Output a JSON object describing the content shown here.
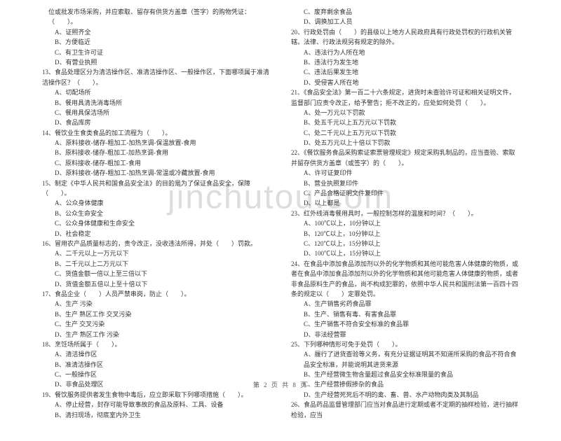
{
  "watermark": "jinchutou.com",
  "footer": "第 2 页 共 8 页",
  "left": {
    "q12_tail": "位或批发市场采购，并应索取、留存有供货方盖章（签字）的购物凭证：（　　）。",
    "q12": {
      "A": "A、证照齐全",
      "B": "B、方便临近",
      "C": "C、有卫生许可证",
      "D": "D、有营业执照"
    },
    "q13": {
      "stem": "13、食品处理区分为清洁操作区、准清洁操作区、一般操作区，下面哪项属于准清洁操作区？（　　）。",
      "A": "A、切配场所",
      "B": "B、餐用具清洗消毒场所",
      "C": "C、餐用具保洁场所",
      "D": "D、食品库房"
    },
    "q14": {
      "stem": "14、餐饮业生食类食品的加工流程为（　　）。",
      "A": "A、原料接收-储存-粗加工-加热烹调-保温放置-食用",
      "B": "B、原料接收-储存-粗加工-加热烹调-食用",
      "C": "C、原料接收-储存-粗加工-食用",
      "D": "D、原料接收-储存-粗加工-加热烹调-常温或冷藏放置-食用"
    },
    "q15": {
      "stem": "15、制定《中华人民共和国食品安全法》的目的是为了保证食品安全，保障（　　）。",
      "A": "A、公众身体健康",
      "B": "B、公众生命安全",
      "C": "C、公众身体健康和生命安全",
      "D": "D、社会稳定"
    },
    "q16": {
      "stem": "16、冒用农产品质量标志的，责令改正，没收违法所得，并处（　　）罚款。",
      "A": "A、二千元以上一万元以下",
      "B": "B、二千元以上二万元以下",
      "C": "C、货值金额一倍以上至三倍以下",
      "D": "D、货值金额五倍以上至十倍以下"
    },
    "q17": {
      "stem": "17、食品企业（　　）人员严禁串岗，防止（　　）。",
      "A": "A、生产  污染",
      "B": "B、生产  熟区工作  交叉污染",
      "C": "C、生产  交叉污染",
      "D": "D、生产  熟区工作  污染"
    },
    "q18": {
      "stem": "18、烹饪场所属于（　　）。",
      "A": "A、清洁操作区",
      "B": "B、准清洁操作区",
      "C": "C、一般操作区",
      "D": "D、非食品处理区"
    },
    "q19": {
      "stem": "19、餐饮服务提供者发生食物中毒后，应立即采取下列哪项措施（　　）。",
      "A": "A、停止经营，封存可能导致事故的食品及原料、工具、设备",
      "B": "B、清扫现场，彻底室内外卫生"
    }
  },
  "right": {
    "q19": {
      "C": "C、废弃剩余食品",
      "D": "D、调换加工人员"
    },
    "q20": {
      "stem": "20、行政处罚由（　　）的县级以上地方人民政府具有行政处罚权的行政机关管辖。法律、行政法规另有规定的除外。",
      "A": "A、违法行为人所在地",
      "B": "B、违法行为发生地",
      "C": "C、违法后果发生地",
      "D": "D、受侵害人所在地"
    },
    "q21": {
      "stem": "21、《食品安全法》第一百二十六条规定，进货时未查验许可证和相关证明文件，监督部门应责令改正，给予警告；拒不改正的，应处如何处罚（　　）。",
      "A": "A、处一万元以下罚款",
      "B": "B、处五千元以上五万元以下罚款",
      "C": "C、处二千元以上五万元以下罚款",
      "D": "D、处五万元以上十倍以下罚款"
    },
    "q22": {
      "stem": "22、《餐饮服务食品采购索证索票管理规定》规定采购乳制品的，应当查验、索取并留存供货方盖章（或签字）的（　　）。",
      "A": "A、许可证复印件",
      "B": "B、营业执照复印件",
      "C": "C、产品合格证明文件复印件",
      "D": "D、以上都是"
    },
    "q23": {
      "stem": "23、红外线消毒餐用具时，一般控制怎样的温度和时间？（　　）。",
      "A": "A、100℃以上，10分钟以上",
      "B": "B、120℃以上，10分钟以上",
      "C": "C、120℃以上，15分钟以上",
      "D": "D、100℃以上，15分钟以上"
    },
    "q24": {
      "stem": "24、在食品中添加食品添加剂以外的化学物质和其他可能危害人体健康的物质，或者在食品中添加食品添加剂以外的化学物质和其他可能危害人体健康的物质，或者非食品原料生产的食品，尚不构成犯罪的，依照中华人民共和国刑法第一百四十四条的规定以（　　）定罪处罚。",
      "A": "A、生产销售劣药食品罪",
      "B": "B、生产、销售有毒、有害食品罪",
      "C": "C、生产销售不符合安全标准的食品罪",
      "D": "D、非法经营罪"
    },
    "q25": {
      "stem": "25、下列哪种情形可免于处罚（　　）。",
      "A": "A、履行了进货查验等义务，有充分证据证明其不知道所采购的食品不符合食品安全标准，并能说明其进货来源",
      "B": "B、生产经营微生物含量超过食品安全标准限量的食品",
      "C": "C、生产经营掺假掺杂的食品",
      "D": "D、生产经营死死后不明的禽、畜、兽、水产动物肉类及其制品"
    },
    "q26": {
      "stem": "26、食品药品监督管理部门应当对食品进行定期或者不定期的抽样检验，进行抽样检验，应当"
    }
  }
}
